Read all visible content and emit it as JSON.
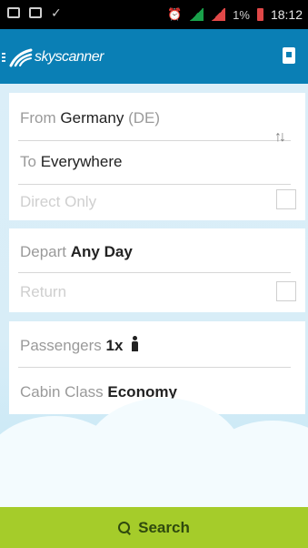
{
  "statusbar": {
    "battery_pct": "1%",
    "time": "18:12"
  },
  "app": {
    "logo_text": "skyscanner"
  },
  "trip": {
    "from_label": "From",
    "from_value": "Germany",
    "from_suffix": "(DE)",
    "to_label": "To",
    "to_value": "Everywhere",
    "direct_only_label": "Direct Only"
  },
  "dates": {
    "depart_label": "Depart",
    "depart_value": "Any Day",
    "return_label": "Return"
  },
  "travellers": {
    "passengers_label": "Passengers",
    "passengers_value": "1x",
    "cabin_label": "Cabin Class",
    "cabin_value": "Economy"
  },
  "search": {
    "button_label": "Search"
  },
  "colors": {
    "brand_blue": "#0a7fb5",
    "search_green": "#a5cc2a"
  }
}
